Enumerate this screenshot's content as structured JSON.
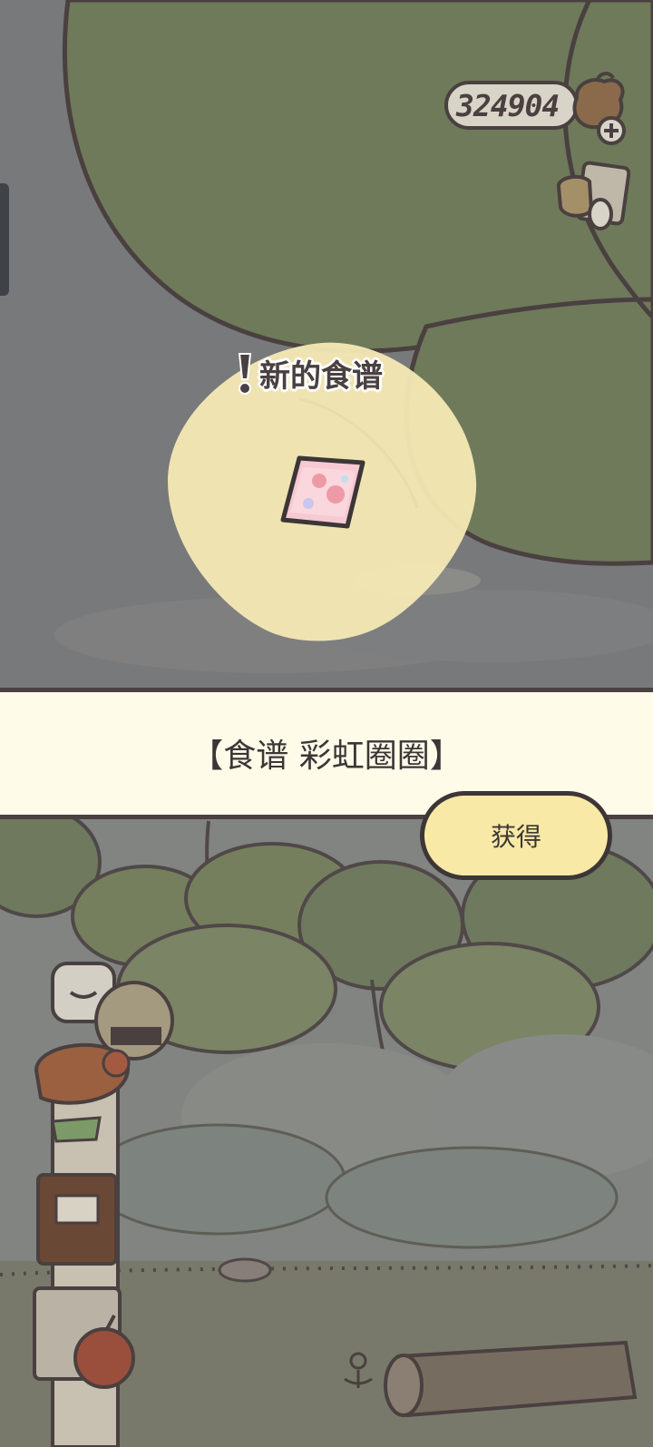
{
  "hud": {
    "currency_value": "324904",
    "currency_icon": "clover-pouch-icon",
    "add_currency_icon": "plus-icon",
    "collection_icon": "cup-and-book-icon"
  },
  "reward": {
    "notice_label": "新的食谱",
    "item_icon": "rainbow-recipe-card-icon"
  },
  "banner": {
    "title": "【食谱 彩虹圈圈】",
    "obtain_label": "获得"
  },
  "colors": {
    "canopy": "#6e7a5a",
    "outline": "#4a4040",
    "glow": "#f5e9b5",
    "banner_bg": "#fefbe9",
    "button_bg": "#f8e9a6"
  }
}
